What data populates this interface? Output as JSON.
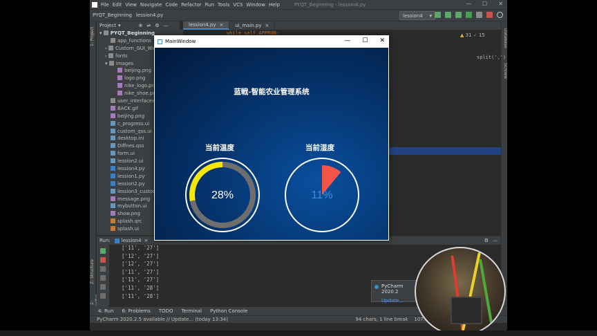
{
  "menubar": {
    "items": [
      "File",
      "Edit",
      "View",
      "Navigate",
      "Code",
      "Refactor",
      "Run",
      "Tools",
      "VCS",
      "Window",
      "Help"
    ],
    "title": "PYQT_Beginning - lession4.py"
  },
  "navbar": {
    "project": "PYQT_Beginning",
    "file": "lession4.py",
    "run_config": "lession4"
  },
  "project_panel": {
    "header": "Project",
    "root": "PYQT_Beginning",
    "items": [
      "app_functions",
      "Custom_GUI_Wid",
      "fonts",
      "images",
      "beijing.png",
      "logo.png",
      "nike_logo.png",
      "nike_shoe.png",
      "user_interfaces",
      "BACK.gif",
      "beijing.png",
      "c_progress.ui",
      "custom_qss.ui",
      "desktop.ini",
      "Diffnes.qss",
      "form.ui",
      "lession2.ui",
      "lession4.py",
      "lession1.py",
      "lession2.py",
      "lession3_custom_q",
      "message.png",
      "mybutton.ui",
      "show.png",
      "splash.qrc",
      "splash.ui"
    ]
  },
  "editor": {
    "tabs": [
      "lession4.py",
      "ui_main.py"
    ],
    "code_line": "while self.APPRUN:",
    "code_split": "split(',')"
  },
  "left_strip": {
    "project": "1: Project",
    "structure": "Z: Structure",
    "favorites": "2: Favorites"
  },
  "right_strip": {
    "database": "Database",
    "scview": "SciView"
  },
  "main_window": {
    "title": "MainWindow",
    "heading": "蓝戦-智能农业管理系统",
    "temp_label": "当前温度",
    "humidity_label": "当前湿度",
    "temp_value": "28%",
    "humidity_value": "11%",
    "temp_percent": 28,
    "humidity_percent": 11
  },
  "run_panel": {
    "label": "Run:",
    "config": "lession4",
    "output": [
      "['11', '27']",
      "['12', '27']",
      "['12', '27']",
      "['11', '27']",
      "['11', '27']",
      "['11', '28']",
      "['11', '28']"
    ]
  },
  "bottom_tabs": [
    "4: Run",
    "6: Problems",
    "TODO",
    "Terminal",
    "Python Console"
  ],
  "status": {
    "left": "PyCharm 2020.2.5 available // Update... (today 13:34)",
    "right": "94 chars, 1 line break",
    "pos": "107:52"
  },
  "notification": {
    "title": "PyCharm 2020.2",
    "link": "Update..."
  },
  "colors": {
    "ring_temp": "#f5e60a",
    "ring_track": "#6e6e6e",
    "pie_humidity": "#f25548",
    "humidity_text": "#3a8de0"
  }
}
